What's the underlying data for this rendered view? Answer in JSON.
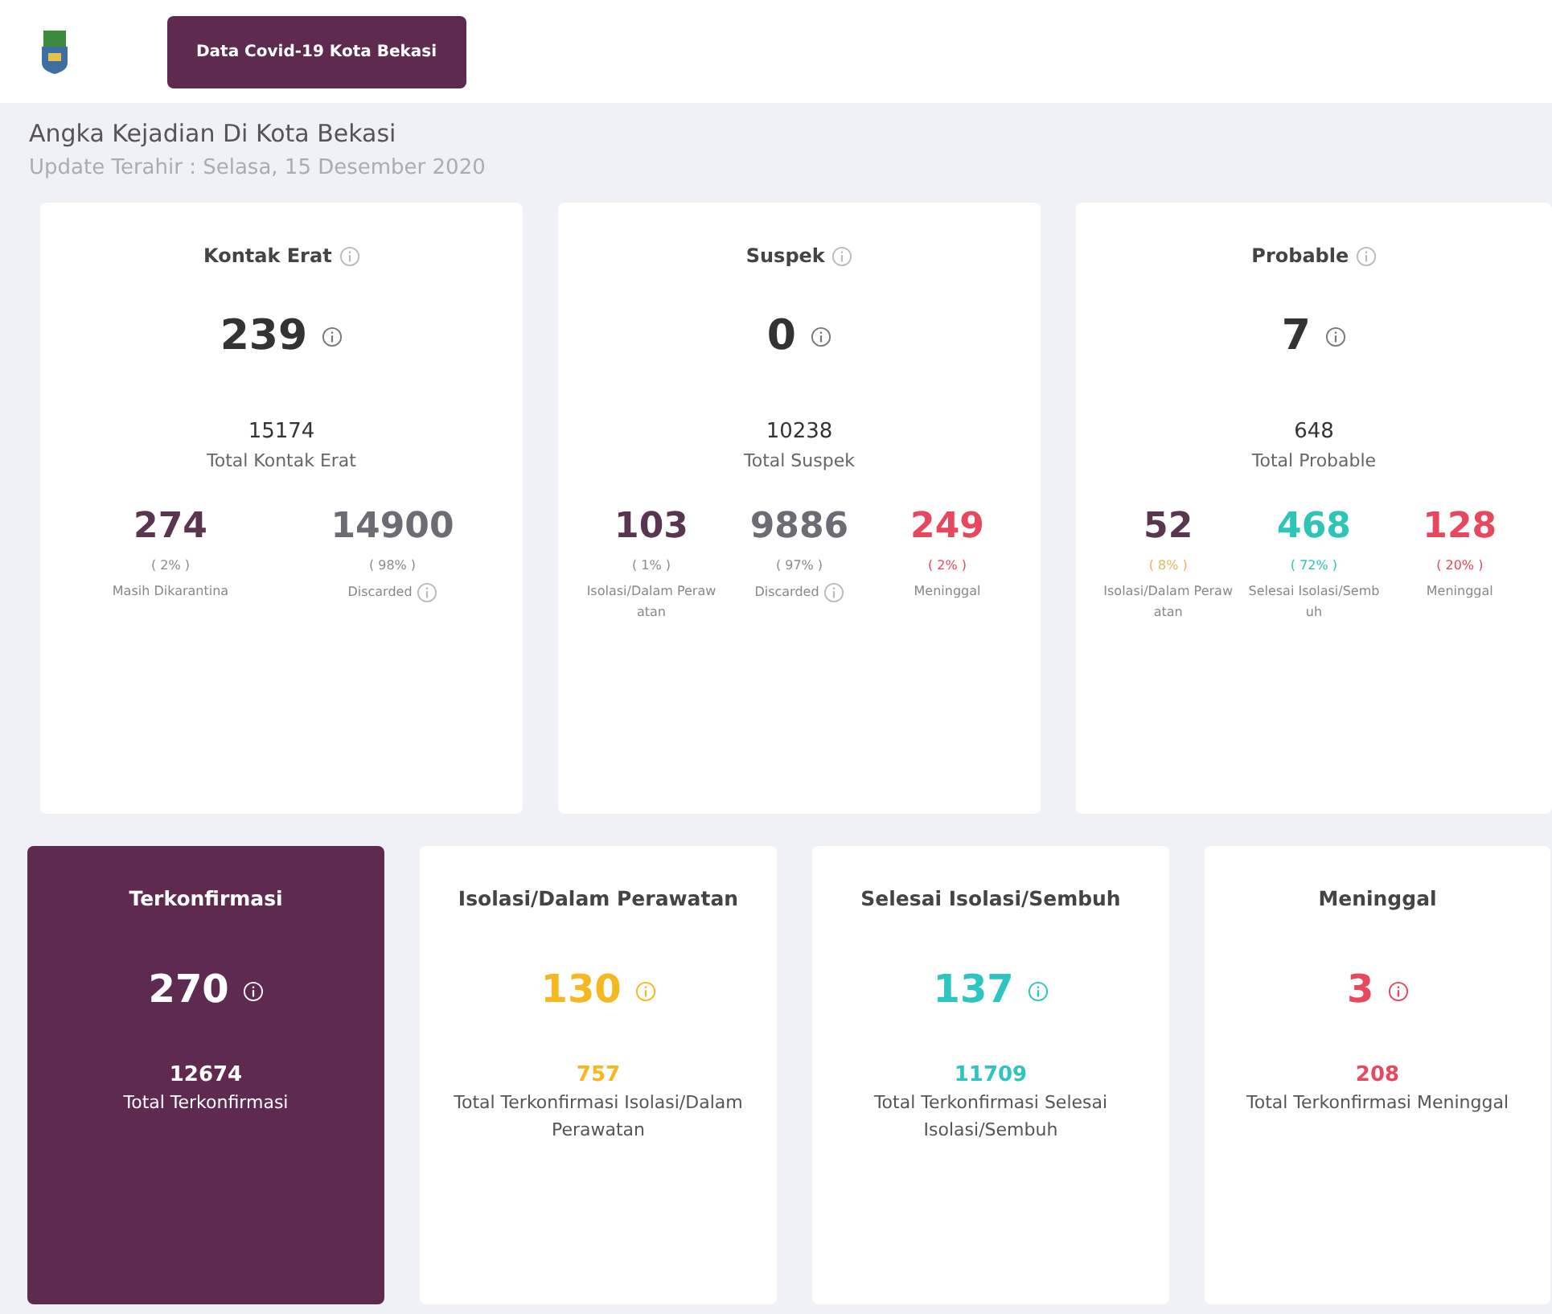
{
  "header": {
    "button": "Data Covid-19 Kota Bekasi"
  },
  "section": {
    "title": "Angka Kejadian Di Kota Bekasi",
    "subtitle": "Update Terahir : Selasa, 15 Desember 2020"
  },
  "summary_cards": [
    {
      "title": "Kontak Erat",
      "value": "239",
      "total": "15174",
      "total_label": "Total Kontak Erat",
      "breakdown": [
        {
          "value": "274",
          "percent": {
            "text": "( 2% )",
            "color": "#8a8a92"
          },
          "label": "Masih Dikarantina",
          "color": "#5a3550",
          "info": false
        },
        {
          "value": "14900",
          "percent": {
            "text": "( 98% )",
            "color": "#8a8a92"
          },
          "label": "Discarded",
          "color": "#6c6c75",
          "info": true
        }
      ]
    },
    {
      "title": "Suspek",
      "value": "0",
      "total": "10238",
      "total_label": "Total Suspek",
      "breakdown": [
        {
          "value": "103",
          "percent": {
            "text": "( 1% )",
            "color": "#8a8a92"
          },
          "label": "Isolasi/Dalam Perawatan",
          "color": "#5a3550",
          "info": false
        },
        {
          "value": "9886",
          "percent": {
            "text": "( 97% )",
            "color": "#8a8a92"
          },
          "label": "Discarded",
          "color": "#6c6c75",
          "info": true
        },
        {
          "value": "249",
          "percent": {
            "text": "( 2% )",
            "color": "#e8485e"
          },
          "label": "Meninggal",
          "color": "#e8485e",
          "info": false
        }
      ]
    },
    {
      "title": "Probable",
      "value": "7",
      "total": "648",
      "total_label": "Total Probable",
      "breakdown": [
        {
          "value": "52",
          "percent": {
            "text": "( 8% )",
            "color": "#e0b860"
          },
          "label": "Isolasi/Dalam Perawatan",
          "color": "#5a3550",
          "info": false
        },
        {
          "value": "468",
          "percent": {
            "text": "( 72% )",
            "color": "#2ec4b6"
          },
          "label": "Selesai Isolasi/Sembuh",
          "color": "#2ec4b6",
          "info": false
        },
        {
          "value": "128",
          "percent": {
            "text": "( 20% )",
            "color": "#e8485e"
          },
          "label": "Meninggal",
          "color": "#e8485e",
          "info": false
        }
      ]
    }
  ],
  "status_cards": [
    {
      "title": "Terkonfirmasi",
      "value": "270",
      "total": "12674",
      "total_label": "Total Terkonfirmasi",
      "highlighted": true,
      "color": "#ffffff"
    },
    {
      "title": "Isolasi/Dalam Perawatan",
      "value": "130",
      "total": "757",
      "total_label": "Total Terkonfirmasi Isolasi/Dalam Perawatan",
      "highlighted": false,
      "color": "#f5b820"
    },
    {
      "title": "Selesai Isolasi/Sembuh",
      "value": "137",
      "total": "11709",
      "total_label": "Total Terkonfirmasi Selesai Isolasi/Sembuh",
      "highlighted": false,
      "color": "#2ec4c0"
    },
    {
      "title": "Meninggal",
      "value": "3",
      "total": "208",
      "total_label": "Total Terkonfirmasi Meninggal",
      "highlighted": false,
      "color": "#e8485e"
    }
  ]
}
